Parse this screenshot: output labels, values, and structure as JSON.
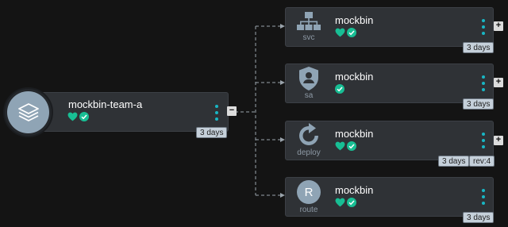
{
  "root": {
    "name": "mockbin-team-a",
    "icon": "layers-icon",
    "age": "3 days",
    "toggle": "−"
  },
  "children": [
    {
      "kind": "svc",
      "icon": "hierarchy-icon",
      "name": "mockbin",
      "age": "3 days",
      "toggle": "+",
      "health": true,
      "synced": true
    },
    {
      "kind": "sa",
      "icon": "user-shield-icon",
      "name": "mockbin",
      "age": "3 days",
      "toggle": "+",
      "health": false,
      "synced": true
    },
    {
      "kind": "deploy",
      "icon": "refresh-icon",
      "name": "mockbin",
      "age": "3 days",
      "rev": "rev:4",
      "toggle": "+",
      "health": true,
      "synced": true
    },
    {
      "kind": "route",
      "icon": "route-letter-icon",
      "letter": "R",
      "name": "mockbin",
      "age": "3 days",
      "health": true,
      "synced": true
    }
  ],
  "colors": {
    "heart": "#18be94",
    "check": "#18be94",
    "kebab": "#18b6c4",
    "link": "#9aa3ab"
  }
}
